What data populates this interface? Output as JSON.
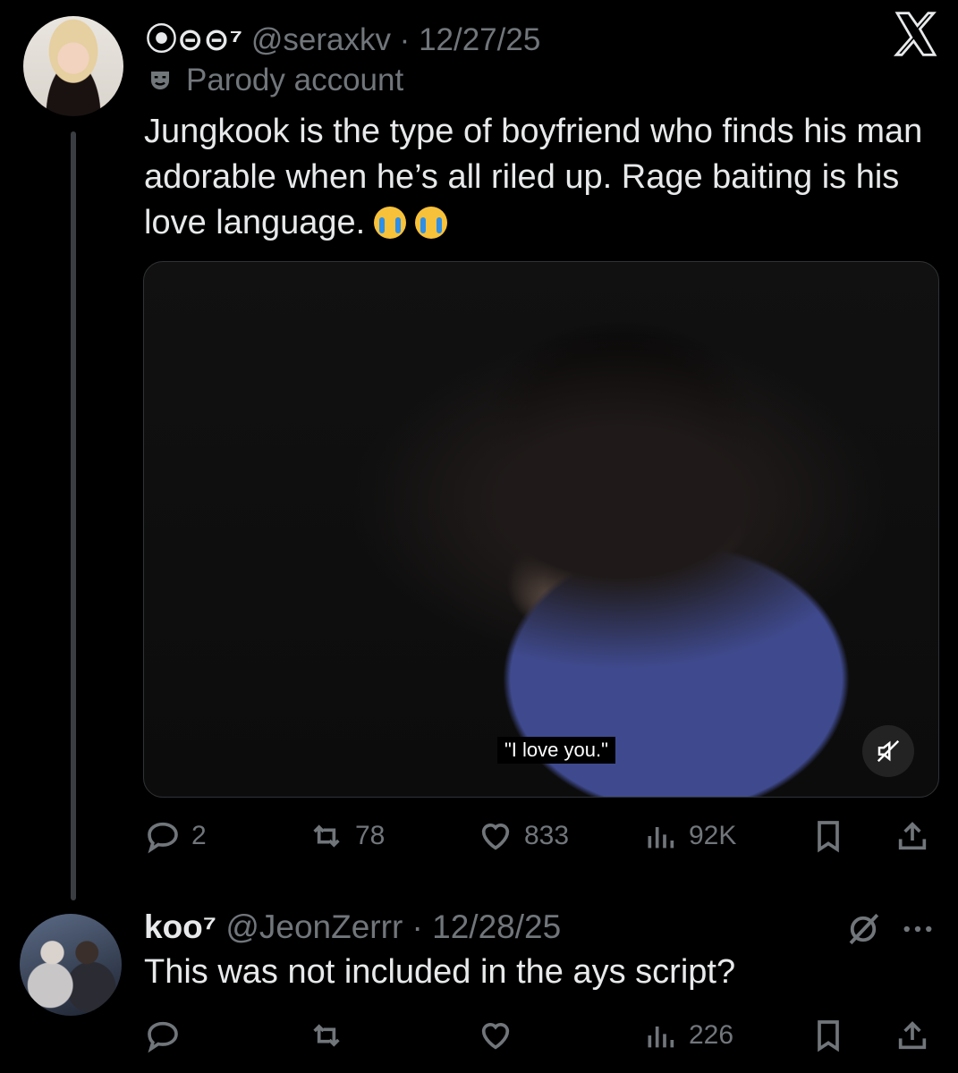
{
  "tweet": {
    "display_name": "⦿⊝⊝⁷",
    "handle": "@seraxkv",
    "date": "12/27/25",
    "label": "Parody account",
    "text": "Jungkook is the type of boyfriend who finds his man adorable when he’s all riled up. Rage baiting is his love language.",
    "media_caption": "\"I love you.\"",
    "stats": {
      "replies": "2",
      "reposts": "78",
      "likes": "833",
      "views": "92K"
    }
  },
  "reply": {
    "display_name": "koo⁷",
    "handle": "@JeonZerrr",
    "date": "12/28/25",
    "text": "This was not included in the ays script?",
    "stats": {
      "views": "226"
    }
  },
  "colors": {
    "background": "#000000",
    "text": "#e7e9ea",
    "muted": "#71767b"
  },
  "icons": [
    "x-logo-icon",
    "parody-mask-icon",
    "mute-icon",
    "reply-icon",
    "repost-icon",
    "like-icon",
    "views-icon",
    "bookmark-icon",
    "share-icon",
    "grok-icon",
    "more-icon"
  ]
}
